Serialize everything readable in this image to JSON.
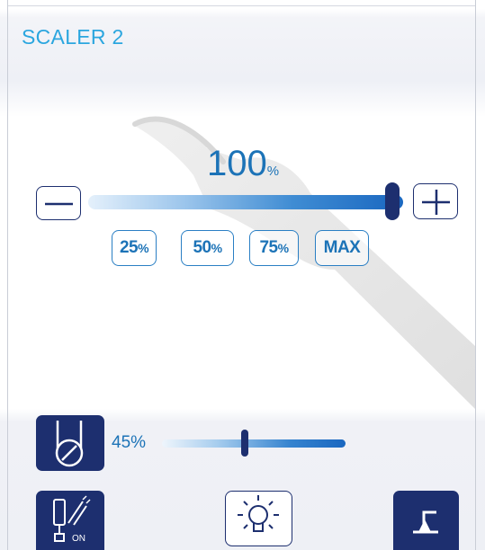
{
  "header": {
    "title": "SCALER 2"
  },
  "power": {
    "value": "100",
    "unit": "%",
    "level_percent": 100
  },
  "presets": [
    {
      "value": "25",
      "unit": "%"
    },
    {
      "value": "50",
      "unit": "%"
    },
    {
      "value": "75",
      "unit": "%"
    },
    {
      "value": "MAX",
      "unit": ""
    }
  ],
  "flow": {
    "label": "45%",
    "level_percent": 45
  },
  "irrigation": {
    "badge": "ON"
  },
  "icons": {
    "decrease": "minus-icon",
    "increase": "plus-icon",
    "flow": "water-flow-icon",
    "irrigation": "irrigation-on-icon",
    "light": "light-bulb-icon",
    "pedal": "foot-pedal-icon"
  },
  "colors": {
    "title": "#2ba6df",
    "accent": "#1c73b7",
    "dark": "#1d2f6f"
  }
}
